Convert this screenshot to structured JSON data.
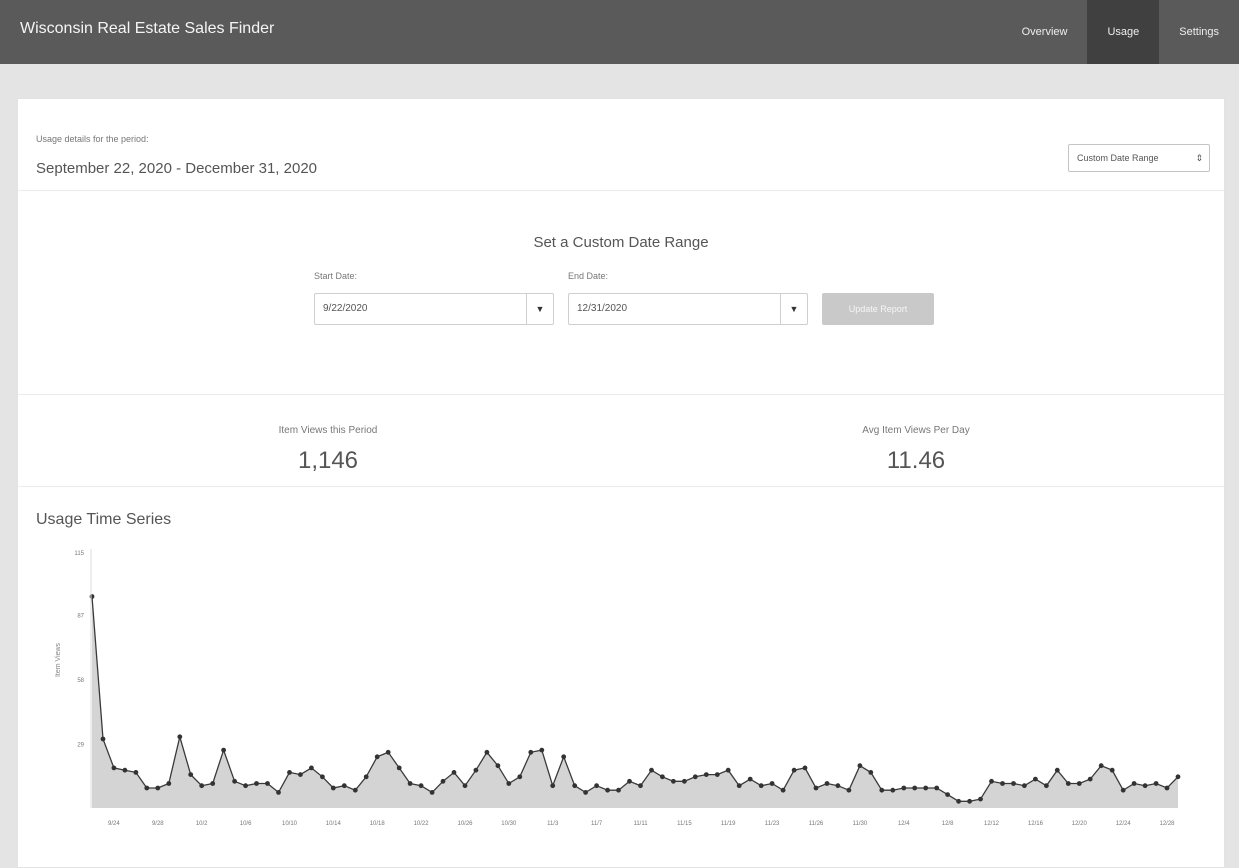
{
  "app": {
    "title": "Wisconsin Real Estate Sales Finder"
  },
  "nav": {
    "items": [
      {
        "label": "Overview",
        "active": false
      },
      {
        "label": "Usage",
        "active": true
      },
      {
        "label": "Settings",
        "active": false
      }
    ]
  },
  "period": {
    "label": "Usage details for the period:",
    "value": "September 22, 2020 - December 31, 2020",
    "range_select": "Custom Date Range"
  },
  "custom_range": {
    "title": "Set a Custom Date Range",
    "start_label": "Start Date:",
    "start_value": "9/22/2020",
    "end_label": "End Date:",
    "end_value": "12/31/2020",
    "update_label": "Update Report"
  },
  "stats": {
    "views_label": "Item Views this Period",
    "views_value": "1,146",
    "avg_label": "Avg Item Views Per Day",
    "avg_value": "11.46"
  },
  "chart_title": "Usage Time Series",
  "colors": {
    "area_fill": "#d4d4d4",
    "line": "#3a3a3a",
    "point": "#333333",
    "topbar": "#5a5a5a",
    "active_tab": "#404040"
  },
  "chart_data": {
    "type": "area",
    "title": "Usage Time Series",
    "ylabel": "Item Views",
    "ylim": [
      0,
      115
    ],
    "y_ticks": [
      0,
      29,
      58,
      87,
      115
    ],
    "y_tick_labels": [
      "",
      "29",
      "58",
      "87",
      "115"
    ],
    "x_tick_labels": [
      "9/24",
      "9/28",
      "10/2",
      "10/6",
      "10/10",
      "10/14",
      "10/18",
      "10/22",
      "10/26",
      "10/30",
      "11/3",
      "11/7",
      "11/11",
      "11/15",
      "11/19",
      "11/23",
      "11/26",
      "11/30",
      "12/4",
      "12/8",
      "12/12",
      "12/16",
      "12/20",
      "12/24",
      "12/28"
    ],
    "x_tick_index": [
      2,
      6,
      10,
      14,
      18,
      22,
      26,
      30,
      34,
      38,
      42,
      46,
      50,
      54,
      58,
      62,
      66,
      70,
      74,
      78,
      82,
      86,
      90,
      94,
      98
    ],
    "values": [
      95,
      31,
      18,
      17,
      16,
      9,
      9,
      11,
      32,
      15,
      10,
      11,
      26,
      12,
      10,
      11,
      11,
      7,
      16,
      15,
      18,
      14,
      9,
      10,
      8,
      14,
      23,
      25,
      18,
      11,
      10,
      7,
      12,
      16,
      10,
      17,
      25,
      19,
      11,
      14,
      25,
      26,
      10,
      23,
      10,
      7,
      10,
      8,
      8,
      12,
      10,
      17,
      14,
      12,
      12,
      14,
      15,
      15,
      17,
      10,
      13,
      10,
      11,
      8,
      17,
      18,
      9,
      11,
      10,
      8,
      19,
      16,
      8,
      8,
      9,
      9,
      9,
      9,
      6,
      3,
      3,
      4,
      12,
      11,
      11,
      10,
      13,
      10,
      17,
      11,
      11,
      13,
      19,
      17,
      8,
      11,
      10,
      11,
      9,
      14
    ],
    "grid": false
  }
}
